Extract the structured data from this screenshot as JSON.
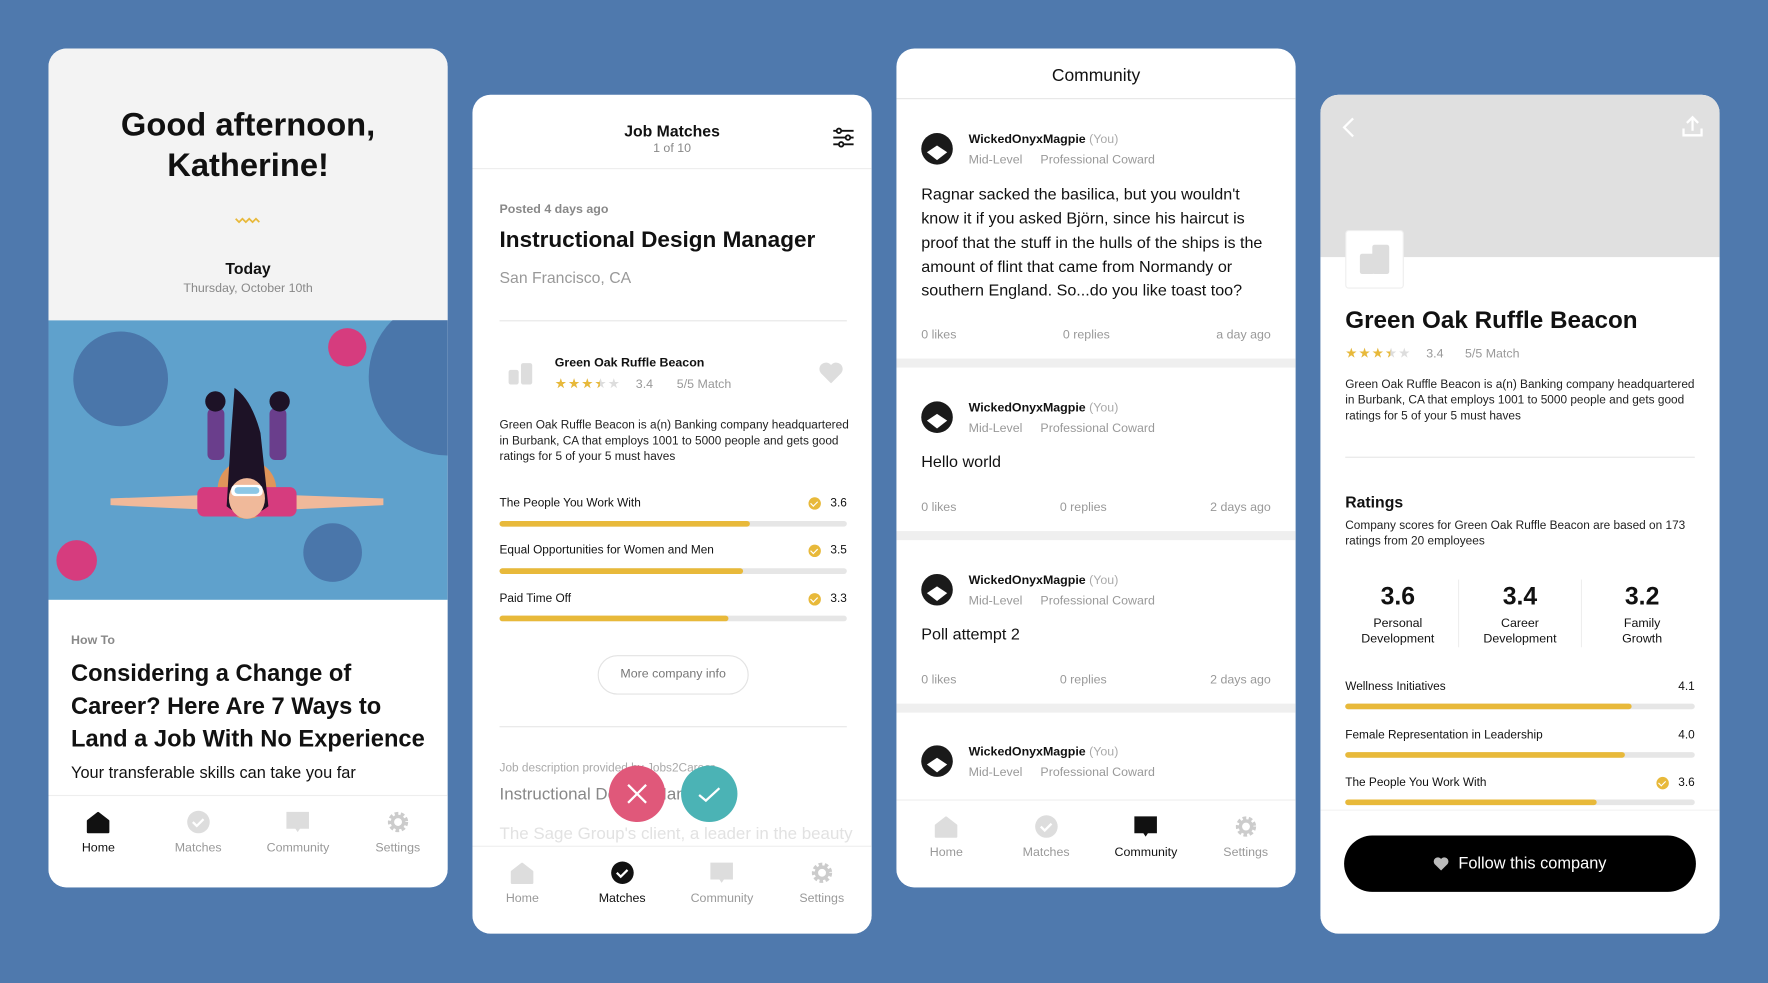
{
  "colors": {
    "background": "#4f79ad",
    "accent": "#e8b93a",
    "reject": "#e0587a",
    "accept": "#4bb3b5"
  },
  "home": {
    "greeting": "Good afternoon,",
    "name": "Katherine!",
    "today_label": "Today",
    "date": "Thursday, October 10th",
    "article": {
      "category": "How To",
      "title": "Considering a Change of Career? Here Are 7 Ways to Land a Job With No Experience",
      "subtitle": "Your transferable skills can take you far"
    }
  },
  "nav_labels": [
    "Home",
    "Matches",
    "Community",
    "Settings"
  ],
  "nav_icons": [
    "home-icon",
    "check-circle-icon",
    "chat-bubble-icon",
    "gear-icon"
  ],
  "matches": {
    "title": "Job Matches",
    "counter": "1 of 10",
    "posted": "Posted 4 days ago",
    "job_title": "Instructional Design Manager",
    "location": "San Francisco, CA",
    "company": {
      "name": "Green Oak Ruffle Beacon",
      "rating": "3.4",
      "rating_value": 3.4,
      "match": "5/5 Match",
      "description": "Green Oak Ruffle Beacon is a(n) Banking company headquartered in Burbank, CA that employs 1001 to 5000 people and gets good ratings for 5 of your 5 must haves"
    },
    "ratings": [
      {
        "label": "The People You Work With",
        "value": "3.6",
        "fraction": 0.72,
        "checked": true
      },
      {
        "label": "Equal Opportunities for Women and Men",
        "value": "3.5",
        "fraction": 0.7,
        "checked": true
      },
      {
        "label": "Paid Time Off",
        "value": "3.3",
        "fraction": 0.66,
        "checked": true
      }
    ],
    "more_button": "More company info",
    "job_desc_source": "Job description provided by Jobs2Career",
    "job_desc_title": "Instructional Design Manager",
    "job_desc_text": "The Sage Group's client, a leader in the beauty"
  },
  "community": {
    "title": "Community",
    "posts": [
      {
        "user": "WickedOnyxMagpie",
        "you": "(You)",
        "level": "Mid-Level",
        "role": "Professional Coward",
        "text": "Ragnar sacked the basilica, but you wouldn't know it if you asked Björn, since his haircut is proof that the stuff in the hulls of the ships is the amount of flint that came from Normandy or southern England. So...do you like toast too?",
        "likes": "0 likes",
        "replies": "0 replies",
        "time": "a day ago"
      },
      {
        "user": "WickedOnyxMagpie",
        "you": "(You)",
        "level": "Mid-Level",
        "role": "Professional Coward",
        "text": "Hello world",
        "likes": "0 likes",
        "replies": "0 replies",
        "time": "2 days ago"
      },
      {
        "user": "WickedOnyxMagpie",
        "you": "(You)",
        "level": "Mid-Level",
        "role": "Professional Coward",
        "text": "Poll attempt 2",
        "likes": "0 likes",
        "replies": "0 replies",
        "time": "2 days ago"
      },
      {
        "user": "WickedOnyxMagpie",
        "you": "(You)",
        "level": "Mid-Level",
        "role": "Professional Coward"
      }
    ]
  },
  "company": {
    "name": "Green Oak Ruffle Beacon",
    "rating": "3.4",
    "match": "5/5 Match",
    "description": "Green Oak Ruffle Beacon is a(n) Banking company headquartered in Burbank, CA that employs 1001 to 5000 people and gets good ratings for 5 of your 5 must haves",
    "ratings_title": "Ratings",
    "ratings_desc": "Company scores for Green Oak Ruffle Beacon are based on 173 ratings from 20 employees",
    "scores": [
      {
        "value": "3.6",
        "label": "Personal Development"
      },
      {
        "value": "3.4",
        "label": "Career Development"
      },
      {
        "value": "3.2",
        "label": "Family Growth"
      }
    ],
    "bars": [
      {
        "label": "Wellness Initiatives",
        "value": "4.1",
        "fraction": 0.82,
        "checked": false
      },
      {
        "label": "Female Representation in Leadership",
        "value": "4.0",
        "fraction": 0.8,
        "checked": false
      },
      {
        "label": "The People You Work With",
        "value": "3.6",
        "fraction": 0.72,
        "checked": true
      }
    ],
    "follow_button": "Follow this company"
  }
}
